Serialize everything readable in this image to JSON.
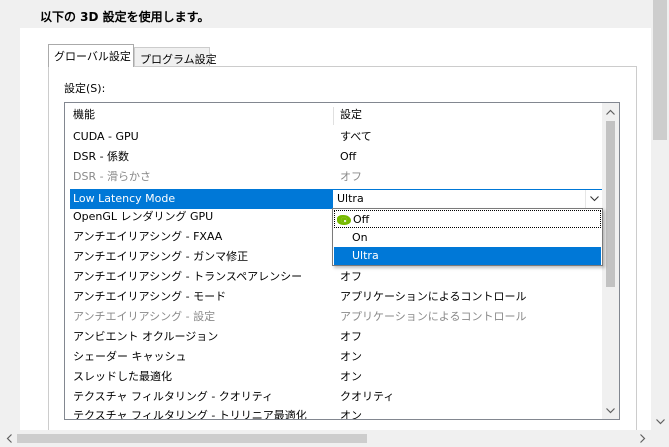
{
  "heading": "以下の 3D 設定を使用します。",
  "tabs": [
    {
      "label": "グローバル設定",
      "active": true
    },
    {
      "label": "プログラム設定",
      "active": false
    }
  ],
  "settings_label": "設定(S):",
  "columns": {
    "feature": "機能",
    "setting": "設定"
  },
  "rows": [
    {
      "feature": "CUDA - GPU",
      "setting": "すべて",
      "disabled": false
    },
    {
      "feature": "DSR - 係数",
      "setting": "Off",
      "disabled": false
    },
    {
      "feature": "DSR - 滑らかさ",
      "setting": "オフ",
      "disabled": true
    },
    {
      "feature": "Low Latency Mode",
      "setting": "Ultra",
      "selected": true
    },
    {
      "feature": "OpenGL レンダリング GPU",
      "setting": ""
    },
    {
      "feature": "アンチエイリアシング - FXAA",
      "setting": ""
    },
    {
      "feature": "アンチエイリアシング - ガンマ修正",
      "setting": ""
    },
    {
      "feature": "アンチエイリアシング - トランスペアレンシー",
      "setting": "オフ",
      "disabled": false
    },
    {
      "feature": "アンチエイリアシング - モード",
      "setting": "アプリケーションによるコントロール",
      "disabled": false
    },
    {
      "feature": "アンチエイリアシング - 設定",
      "setting": "アプリケーションによるコントロール",
      "disabled": true
    },
    {
      "feature": "アンビエント オクルージョン",
      "setting": "オフ",
      "disabled": false
    },
    {
      "feature": "シェーダー キャッシュ",
      "setting": "オン",
      "disabled": false
    },
    {
      "feature": "スレッドした最適化",
      "setting": "オン",
      "disabled": false
    },
    {
      "feature": "テクスチャ フィルタリング - クオリティ",
      "setting": "クオリティ",
      "disabled": false
    },
    {
      "feature": "テクスチャ フィルタリング - トリリニア最適化",
      "setting": "オン",
      "disabled": false
    }
  ],
  "dropdown": {
    "current": "Ultra",
    "options": [
      {
        "label": "Off",
        "icon": "nvidia-logo-icon",
        "state": "focused"
      },
      {
        "label": "On",
        "state": "normal"
      },
      {
        "label": "Ultra",
        "state": "selected"
      }
    ]
  },
  "colors": {
    "selection": "#0078d7",
    "disabled_text": "#8a8a8a",
    "nvidia_green": "#76b900"
  }
}
